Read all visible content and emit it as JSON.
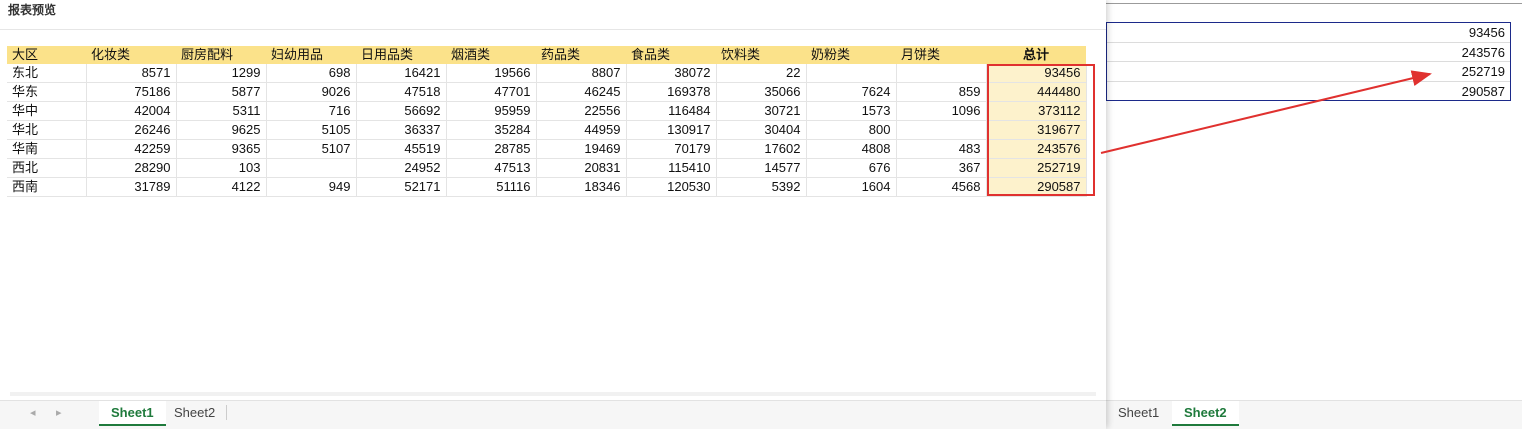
{
  "preview": {
    "title": "报表预览",
    "headers": [
      "大区",
      "化妆类",
      "厨房配料",
      "妇幼用品",
      "日用品类",
      "烟酒类",
      "药品类",
      "食品类",
      "饮料类",
      "奶粉类",
      "月饼类",
      "总计"
    ],
    "rows": [
      [
        "东北",
        "8571",
        "1299",
        "698",
        "16421",
        "19566",
        "8807",
        "38072",
        "22",
        "",
        "",
        "93456"
      ],
      [
        "华东",
        "75186",
        "5877",
        "9026",
        "47518",
        "47701",
        "46245",
        "169378",
        "35066",
        "7624",
        "859",
        "444480"
      ],
      [
        "华中",
        "42004",
        "5311",
        "716",
        "56692",
        "95959",
        "22556",
        "116484",
        "30721",
        "1573",
        "1096",
        "373112"
      ],
      [
        "华北",
        "26246",
        "9625",
        "5105",
        "36337",
        "35284",
        "44959",
        "130917",
        "30404",
        "800",
        "",
        "319677"
      ],
      [
        "华南",
        "42259",
        "9365",
        "5107",
        "45519",
        "28785",
        "19469",
        "70179",
        "17602",
        "4808",
        "483",
        "243576"
      ],
      [
        "西北",
        "28290",
        "103",
        "",
        "24952",
        "47513",
        "20831",
        "115410",
        "14577",
        "676",
        "367",
        "252719"
      ],
      [
        "西南",
        "31789",
        "4122",
        "949",
        "52171",
        "51116",
        "18346",
        "120530",
        "5392",
        "1604",
        "4568",
        "290587"
      ]
    ],
    "tabs": [
      {
        "label": "Sheet1",
        "active": true
      },
      {
        "label": "Sheet2",
        "active": false
      }
    ]
  },
  "right_sheet": {
    "values": [
      "93456",
      "243576",
      "252719",
      "290587"
    ],
    "tabs": [
      {
        "label": "Sheet1",
        "active": false
      },
      {
        "label": "Sheet2",
        "active": true
      }
    ]
  },
  "colors": {
    "header_bg": "#fbe28a",
    "total_bg": "#fdf2cc",
    "highlight": "#e0312f",
    "active_tab": "#1f7a3c",
    "selection_border": "#1c2a8a"
  }
}
